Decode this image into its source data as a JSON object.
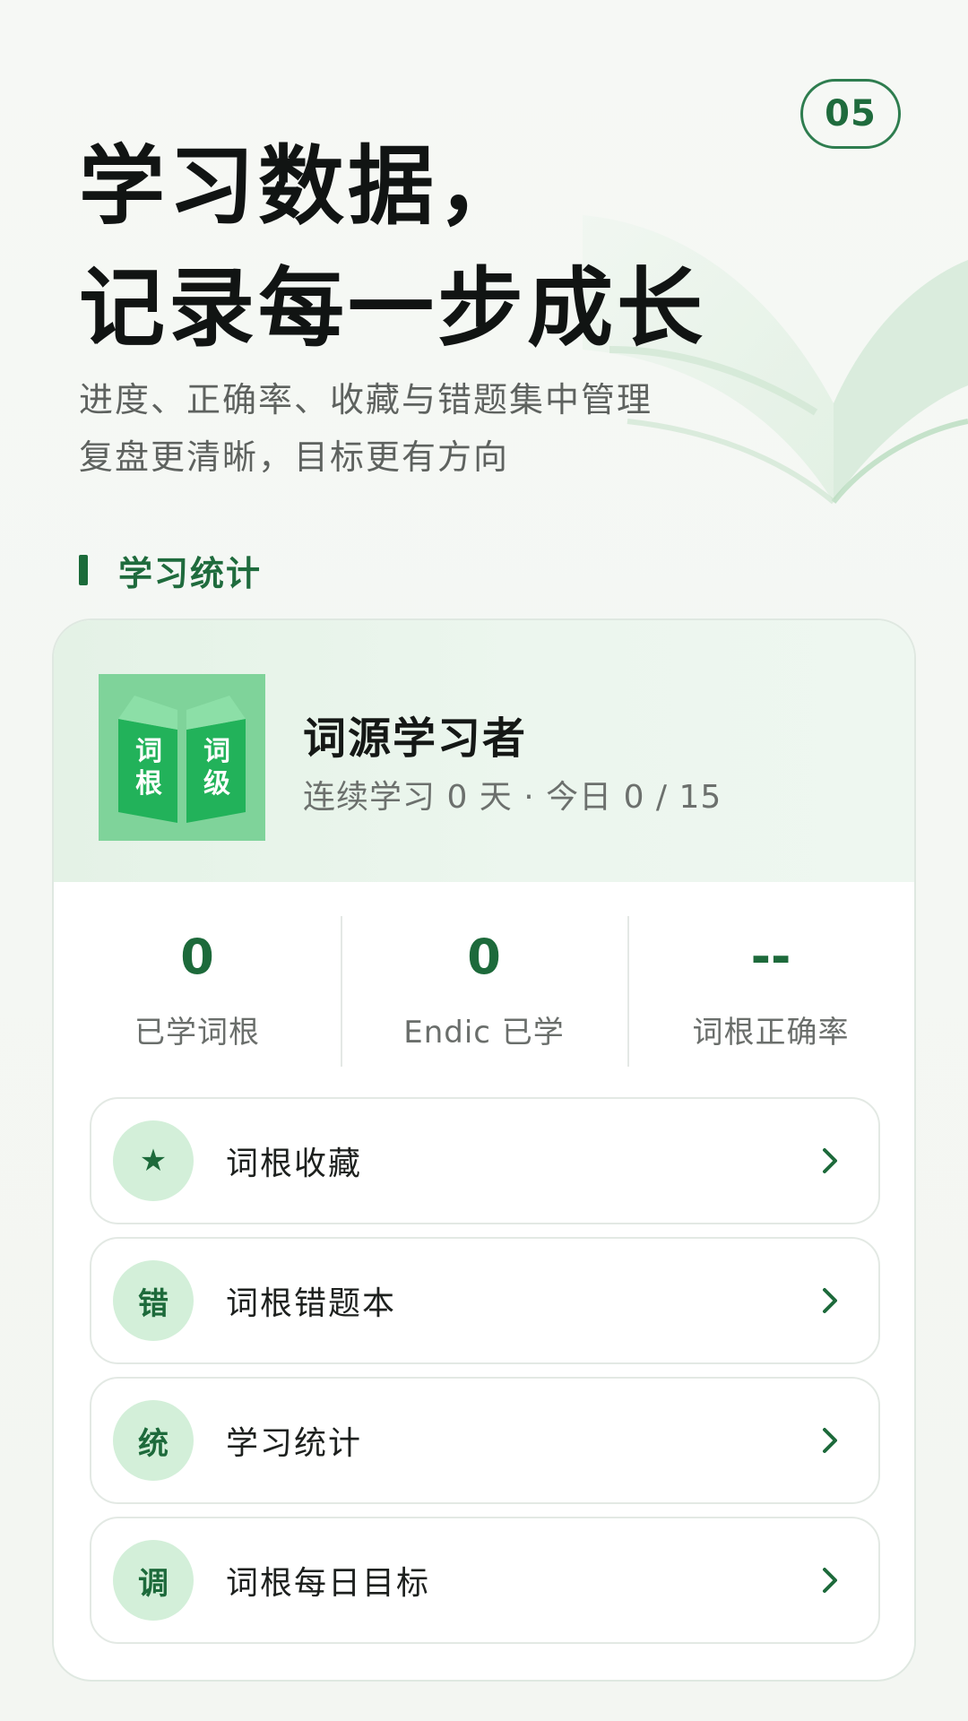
{
  "page_number": "05",
  "hero": {
    "title_line1": "学习数据，",
    "title_line2": "记录每一步成长",
    "subtitle_line1": "进度、正确率、收藏与错题集中管理",
    "subtitle_line2": "复盘更清晰，目标更有方向"
  },
  "section": {
    "title": "学习统计"
  },
  "profile": {
    "logo_text": [
      "词",
      "根",
      "词",
      "级"
    ],
    "name": "词源学习者",
    "meta": "连续学习 0 天 · 今日 0 / 15"
  },
  "stats": [
    {
      "value": "0",
      "label": "已学词根"
    },
    {
      "value": "0",
      "label": "Endic 已学"
    },
    {
      "value": "--",
      "label": "词根正确率"
    }
  ],
  "menu": [
    {
      "icon": "star-icon",
      "icon_text": "★",
      "label": "词根收藏"
    },
    {
      "icon": "text-icon",
      "icon_text": "错",
      "label": "词根错题本"
    },
    {
      "icon": "text-icon",
      "icon_text": "统",
      "label": "学习统计"
    },
    {
      "icon": "text-icon",
      "icon_text": "调",
      "label": "词根每日目标"
    }
  ],
  "colors": {
    "accent": "#1d6a3b",
    "icon_bg": "#d3efd9",
    "profile_bg": "#e4f2e6"
  }
}
